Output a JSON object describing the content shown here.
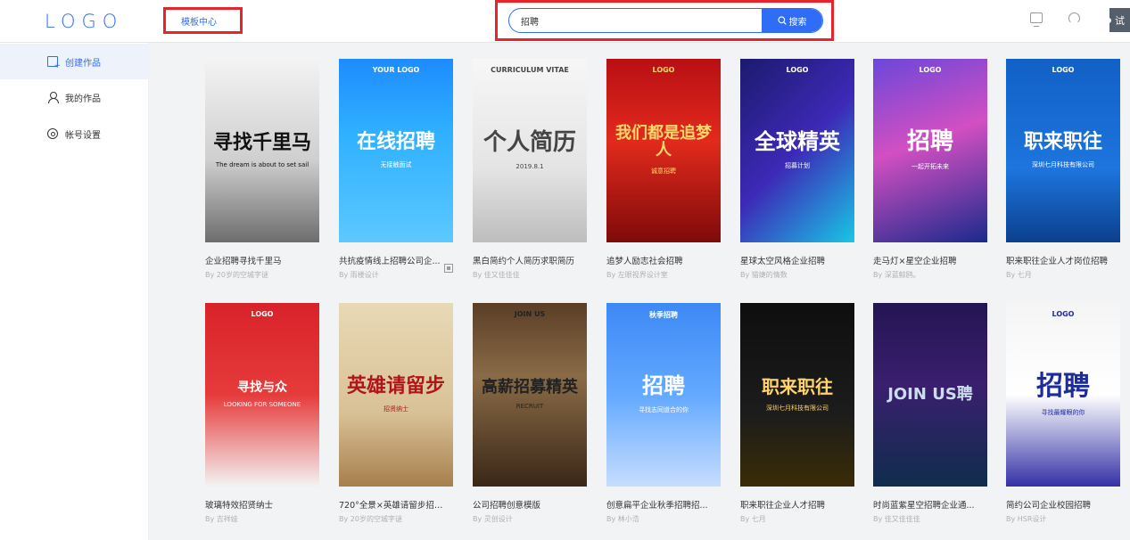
{
  "header": {
    "logo": "LOGO",
    "template_center": "模板中心",
    "search_value": "招聘",
    "search_button": "搜索",
    "trial": "试"
  },
  "sidebar": {
    "items": [
      {
        "label": "创建作品",
        "active": true
      },
      {
        "label": "我的作品",
        "active": false
      },
      {
        "label": "帐号设置",
        "active": false
      }
    ]
  },
  "cards": [
    {
      "title": "企业招聘寻找千里马",
      "author": "By 20岁的空城字谜",
      "art": "寻找千里马",
      "sub": "The dream is about to set sail",
      "logo": "",
      "qr": false
    },
    {
      "title": "共抗疫情线上招聘公司企...",
      "author": "By 雨楼设计",
      "art": "在线招聘",
      "sub": "无接触面试",
      "logo": "YOUR LOGO",
      "qr": true
    },
    {
      "title": "黑白简约个人简历求职简历",
      "author": "By 佳又佳佳佳",
      "art": "个人简历",
      "sub": "2019.8.1",
      "logo": "CURRICULUM VITAE",
      "qr": false
    },
    {
      "title": "追梦人励志社会招聘",
      "author": "By 左眼视界设计室",
      "art": "我们都是追梦人",
      "sub": "诚意招聘",
      "logo": "LOGO",
      "qr": false
    },
    {
      "title": "星球太空风格企业招聘",
      "author": "By 猫婕的情数",
      "art": "全球精英",
      "sub": "招募计划",
      "logo": "LOGO",
      "qr": false
    },
    {
      "title": "走马灯×星空企业招聘",
      "author": "By 深蓝鲸鸥。",
      "art": "招聘",
      "sub": "一起开拓未来",
      "logo": "LOGO",
      "qr": false
    },
    {
      "title": "职来职往企业人才岗位招聘",
      "author": "By 七月",
      "art": "职来职往",
      "sub": "深圳七月科技有限公司",
      "logo": "LOGO",
      "qr": false
    },
    {
      "title": "玻璃特效招贤纳士",
      "author": "By 吉祥娃",
      "art": "寻找与众",
      "sub": "LOOKING FOR SOMEONE",
      "logo": "LOGO",
      "qr": false
    },
    {
      "title": "720°全景×英雄请留步招兵...",
      "author": "By 20岁的空城字谜",
      "art": "英雄请留步",
      "sub": "招贤纳士",
      "logo": "",
      "qr": false
    },
    {
      "title": "公司招聘创意模版",
      "author": "By 灵创设计",
      "art": "高薪招募精英",
      "sub": "RECRUIT",
      "logo": "JOIN US",
      "qr": false
    },
    {
      "title": "创意扁平企业秋季招聘招...",
      "author": "By 林小浩",
      "art": "招聘",
      "sub": "寻找志同道合的你",
      "logo": "秋季招聘",
      "qr": false
    },
    {
      "title": "职来职往企业人才招聘",
      "author": "By 七月",
      "art": "职来职往",
      "sub": "深圳七月科技有限公司",
      "logo": "",
      "qr": false
    },
    {
      "title": "时尚蓝紫星空招聘企业通...",
      "author": "By 佳又佳佳佳",
      "art": "JOIN US聘",
      "sub": "",
      "logo": "",
      "qr": false
    },
    {
      "title": "简约公司企业校园招聘",
      "author": "By HSR设计",
      "art": "招聘",
      "sub": "寻找最耀眼的你",
      "logo": "LOGO",
      "qr": false
    }
  ]
}
